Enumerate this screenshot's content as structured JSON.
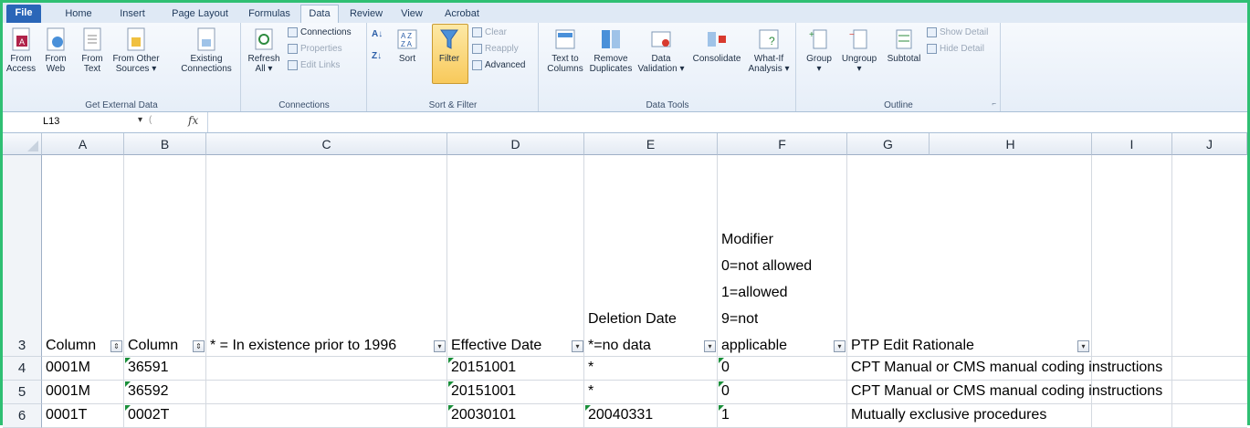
{
  "tabs": [
    "File",
    "Home",
    "Insert",
    "Page Layout",
    "Formulas",
    "Data",
    "Review",
    "View",
    "Acrobat"
  ],
  "ribbon": {
    "external": {
      "label": "Get External Data",
      "from_access": [
        "From",
        "Access"
      ],
      "from_web": [
        "From",
        "Web"
      ],
      "from_text": [
        "From",
        "Text"
      ],
      "from_other": [
        "From Other",
        "Sources ▾"
      ],
      "existing": [
        "Existing",
        "Connections"
      ]
    },
    "connections": {
      "label": "Connections",
      "refresh": [
        "Refresh",
        "All ▾"
      ],
      "connections": "Connections",
      "properties": "Properties",
      "edit_links": "Edit Links"
    },
    "sortfilter": {
      "label": "Sort & Filter",
      "sort": "Sort",
      "filter": "Filter",
      "clear": "Clear",
      "reapply": "Reapply",
      "advanced": "Advanced"
    },
    "datatools": {
      "label": "Data Tools",
      "text_to_columns": [
        "Text to",
        "Columns"
      ],
      "remove_duplicates": [
        "Remove",
        "Duplicates"
      ],
      "data_validation": [
        "Data",
        "Validation ▾"
      ],
      "consolidate": "Consolidate",
      "whatif": [
        "What-If",
        "Analysis ▾"
      ]
    },
    "outline": {
      "label": "Outline",
      "group": "Group",
      "ungroup": "Ungroup",
      "subtotal": "Subtotal",
      "show_detail": "Show Detail",
      "hide_detail": "Hide Detail"
    }
  },
  "formula_bar": {
    "cell_ref": "L13",
    "fx": "fx",
    "formula": ""
  },
  "columns": [
    "A",
    "B",
    "C",
    "D",
    "E",
    "F",
    "G",
    "H",
    "I",
    "J"
  ],
  "header_row": {
    "num": "3",
    "a": "Column",
    "b": "Column",
    "c": "* = In existence prior to 1996",
    "d": "Effective Date",
    "e_line1": "Deletion Date",
    "e_line2": "*=no data",
    "f_lines": [
      "Modifier",
      "0=not allowed",
      "1=allowed",
      "9=not",
      "applicable"
    ],
    "g": "PTP Edit Rationale"
  },
  "rows": [
    {
      "num": "4",
      "a": "0001M",
      "b": "36591",
      "c": "",
      "d": "20151001",
      "e": "*",
      "f": "0",
      "g": "CPT Manual or CMS manual coding instructions"
    },
    {
      "num": "5",
      "a": "0001M",
      "b": "36592",
      "c": "",
      "d": "20151001",
      "e": "*",
      "f": "0",
      "g": "CPT Manual or CMS manual coding instructions"
    },
    {
      "num": "6",
      "a": "0001T",
      "b": "0002T",
      "c": "",
      "d": "20030101",
      "e": "20040331",
      "f": "1",
      "g": "Mutually exclusive procedures"
    }
  ]
}
